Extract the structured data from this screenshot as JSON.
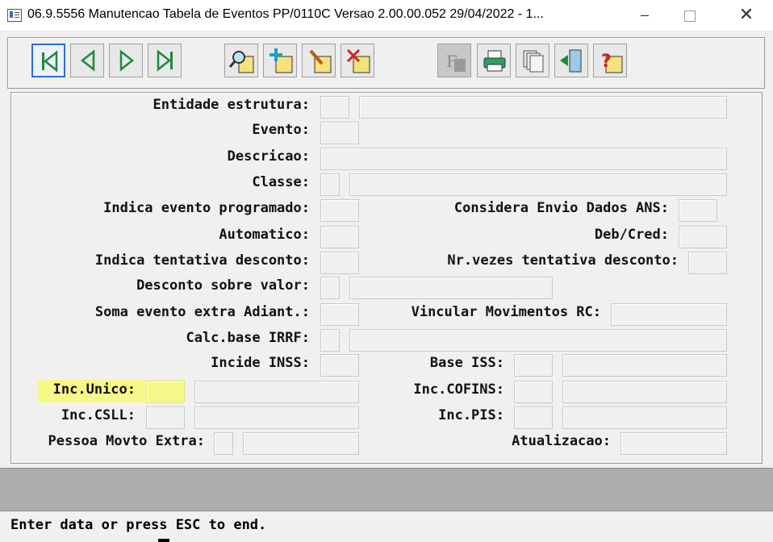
{
  "window": {
    "title": "06.9.5556 Manutencao  Tabela de Eventos PP/0110C Versao 2.00.00.052 29/04/2022 - 1...",
    "minimize_glyph": "—",
    "close_glyph": "✕"
  },
  "toolbar": {
    "buttons": [
      {
        "name": "first-record",
        "icon": "first-icon"
      },
      {
        "name": "previous-record",
        "icon": "previous-icon"
      },
      {
        "name": "next-record",
        "icon": "next-icon"
      },
      {
        "name": "last-record",
        "icon": "last-icon"
      },
      {
        "name": "search",
        "icon": "magnifier-icon"
      },
      {
        "name": "add",
        "icon": "add-icon"
      },
      {
        "name": "edit",
        "icon": "pencil-icon"
      },
      {
        "name": "delete",
        "icon": "delete-x-icon"
      },
      {
        "name": "filter",
        "icon": "filter-f-icon",
        "disabled": true
      },
      {
        "name": "print",
        "icon": "printer-icon"
      },
      {
        "name": "copy",
        "icon": "copy-pages-icon"
      },
      {
        "name": "exit",
        "icon": "exit-door-icon"
      },
      {
        "name": "help",
        "icon": "help-question-icon"
      }
    ]
  },
  "form": {
    "labels": {
      "entidade_estrutura": "Entidade estrutura:",
      "evento": "Evento:",
      "descricao": "Descricao:",
      "classe": "Classe:",
      "indica_evento_programado": "Indica evento programado:",
      "considera_envio_dados_ans": "Considera Envio Dados ANS:",
      "automatico": "Automatico:",
      "deb_cred": "Deb/Cred:",
      "indica_tentativa_desconto": "Indica tentativa desconto:",
      "nr_vezes_tentativa_desconto": "Nr.vezes tentativa desconto:",
      "desconto_sobre_valor": "Desconto sobre valor:",
      "soma_evento_extra_adiant": "Soma evento extra Adiant.:",
      "vincular_movimentos_rc": "Vincular Movimentos RC:",
      "calc_base_irrf": "Calc.base IRRF:",
      "incide_inss": "Incide INSS:",
      "base_iss": "Base ISS:",
      "inc_unico": "Inc.Unico:",
      "inc_cofins": "Inc.COFINS:",
      "inc_csll": "Inc.CSLL:",
      "inc_pis": "Inc.PIS:",
      "pessoa_movto_extra": "Pessoa Movto Extra:",
      "atualizacao": "Atualizacao:"
    },
    "highlight_color": "#f6f88a"
  },
  "status": {
    "message": "Enter data or press ESC to end."
  }
}
